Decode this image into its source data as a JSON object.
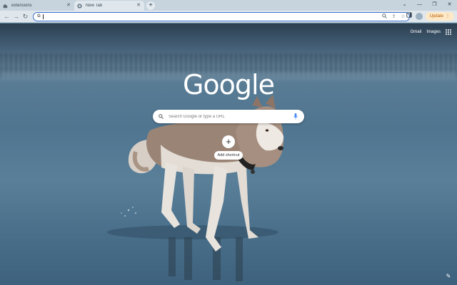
{
  "tabs": [
    {
      "title": "extensions",
      "icon": "puzzle-icon",
      "active": false
    },
    {
      "title": "New Tab",
      "icon": "chrome-icon",
      "active": true
    }
  ],
  "toolbar": {
    "omnibox_value": "",
    "update_label": "Update"
  },
  "top_links": {
    "gmail": "Gmail",
    "images": "Images"
  },
  "logo_text": "Google",
  "search": {
    "placeholder": "Search Google or type a URL"
  },
  "shortcut": {
    "label": "Add shortcut"
  },
  "colors": {
    "omnibox_border": "#3b6fd0",
    "update_bg": "#fde9c8",
    "update_text": "#b35a00"
  }
}
